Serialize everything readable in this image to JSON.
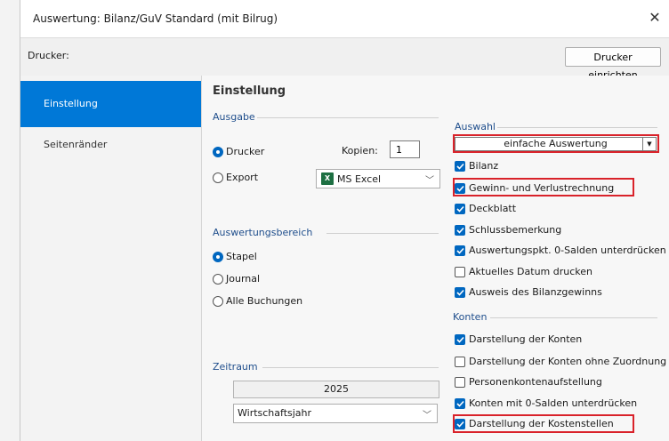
{
  "window": {
    "title": "Auswertung: Bilanz/GuV Standard (mit Bilrug)"
  },
  "printer": {
    "label": "Drucker:",
    "setup_button": "Drucker einrichten"
  },
  "nav": {
    "items": [
      {
        "label": "Einstellung",
        "active": true
      },
      {
        "label": "Seitenränder",
        "active": false
      }
    ]
  },
  "content": {
    "heading": "Einstellung"
  },
  "ausgabe": {
    "title": "Ausgabe",
    "options": [
      {
        "label": "Drucker",
        "selected": true
      },
      {
        "label": "Export",
        "selected": false
      }
    ],
    "kopien_label": "Kopien:",
    "kopien_value": "1",
    "export_format": "MS Excel"
  },
  "bereich": {
    "title": "Auswertungsbereich",
    "options": [
      {
        "label": "Stapel",
        "selected": true
      },
      {
        "label": "Journal",
        "selected": false
      },
      {
        "label": "Alle Buchungen",
        "selected": false
      }
    ]
  },
  "zeitraum": {
    "title": "Zeitraum",
    "year": "2025",
    "period": "Wirtschaftsjahr"
  },
  "auswahl": {
    "title": "Auswahl",
    "select_value": "einfache Auswertung",
    "items": [
      {
        "label": "Bilanz",
        "checked": true
      },
      {
        "label": "Gewinn- und Verlustrechnung",
        "checked": true
      },
      {
        "label": "Deckblatt",
        "checked": true
      },
      {
        "label": "Schlussbemerkung",
        "checked": true
      },
      {
        "label": "Auswertungspkt. 0-Salden unterdrücken",
        "checked": true
      },
      {
        "label": "Aktuelles Datum drucken",
        "checked": false
      },
      {
        "label": "Ausweis des Bilanzgewinns",
        "checked": true
      }
    ]
  },
  "konten": {
    "title": "Konten",
    "items": [
      {
        "label": "Darstellung der Konten",
        "checked": true
      },
      {
        "label": "Darstellung der Konten ohne Zuordnung",
        "checked": false
      },
      {
        "label": "Personenkontenaufstellung",
        "checked": false
      },
      {
        "label": "Konten mit 0-Salden unterdrücken",
        "checked": true
      },
      {
        "label": "Darstellung der Kostenstellen",
        "checked": true
      }
    ]
  },
  "colors": {
    "accent": "#0078d7",
    "check": "#0067c0",
    "highlight": "#d9222a",
    "group_title": "#1f4e8c"
  }
}
